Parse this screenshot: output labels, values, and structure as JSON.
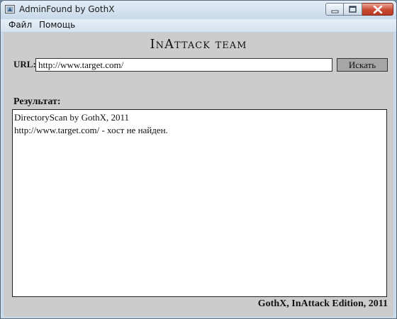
{
  "window": {
    "title": "AdminFound by GothX",
    "icon": "app-icon"
  },
  "menu": {
    "items": [
      {
        "label": "Файл"
      },
      {
        "label": "Помощь"
      }
    ]
  },
  "header": {
    "title": "InAttack team"
  },
  "form": {
    "url_label": "URL:",
    "url_value": "http://www.target.com/",
    "search_label": "Искать"
  },
  "result": {
    "label": "Результат:",
    "lines": [
      "DirectoryScan by GothX, 2011",
      "http://www.target.com/ - хост не найден."
    ]
  },
  "footer": {
    "text": "GothX, InAttack Edition, 2011"
  },
  "colors": {
    "client_bg": "#cccccc",
    "button_bg": "#a6a6a6",
    "close_button": "#c94a33"
  }
}
